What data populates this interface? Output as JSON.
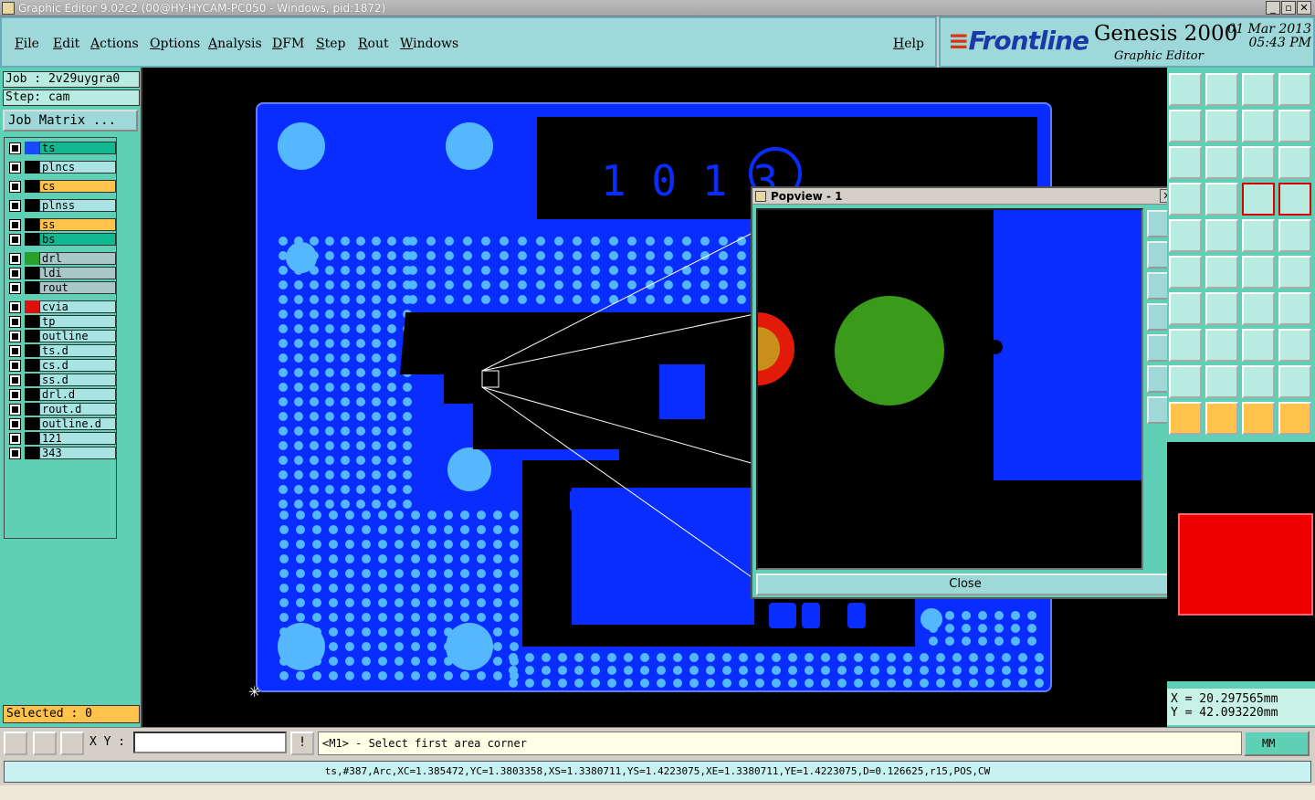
{
  "window": {
    "title": "Graphic Editor 9.02c2 (00@HY-HYCAM-PC050 - Windows, pid:1872)"
  },
  "menu": {
    "items": [
      "File",
      "Edit",
      "Actions",
      "Options",
      "Analysis",
      "DFM",
      "Step",
      "Rout",
      "Windows"
    ],
    "help": "Help"
  },
  "brand": {
    "logo": "Frontline",
    "product": "Genesis 2000",
    "subtitle": "Graphic Editor",
    "date": "01 Mar 2013",
    "time": "05:43 PM"
  },
  "job": {
    "job_label": "Job : 2v29uygra0",
    "step_label": "Step: cam",
    "matrix_button": "Job Matrix ..."
  },
  "layers": [
    {
      "name": "ts",
      "color": "#1a4aff",
      "bg": "#14b890"
    },
    {
      "name": "plncs",
      "color": "#000000",
      "bg": "#a8e4e4"
    },
    {
      "name": "cs",
      "color": "#000000",
      "bg": "#ffc24a"
    },
    {
      "name": "plnss",
      "color": "#000000",
      "bg": "#a8e4e4"
    },
    {
      "name": "ss",
      "color": "#000000",
      "bg": "#ffc24a"
    },
    {
      "name": "bs",
      "color": "#000000",
      "bg": "#14b890"
    },
    {
      "name": "drl",
      "color": "#2aa02a",
      "bg": "#a8c8c8"
    },
    {
      "name": "ldi",
      "color": "#000000",
      "bg": "#a8c8c8"
    },
    {
      "name": "rout",
      "color": "#000000",
      "bg": "#a8c8c8"
    },
    {
      "name": "cvia",
      "color": "#e01010",
      "bg": "#a8e4e4"
    },
    {
      "name": "tp",
      "color": "#000000",
      "bg": "#a8e4e4"
    },
    {
      "name": "outline",
      "color": "#000000",
      "bg": "#a8e4e4"
    },
    {
      "name": "ts.d",
      "color": "#000000",
      "bg": "#a8e4e4"
    },
    {
      "name": "cs.d",
      "color": "#000000",
      "bg": "#a8e4e4"
    },
    {
      "name": "ss.d",
      "color": "#000000",
      "bg": "#a8e4e4"
    },
    {
      "name": "drl.d",
      "color": "#000000",
      "bg": "#a8e4e4"
    },
    {
      "name": "rout.d",
      "color": "#000000",
      "bg": "#a8e4e4"
    },
    {
      "name": "outline.d",
      "color": "#000000",
      "bg": "#a8e4e4"
    },
    {
      "name": "121",
      "color": "#000000",
      "bg": "#a8e4e4"
    },
    {
      "name": "343",
      "color": "#000000",
      "bg": "#a8e4e4"
    }
  ],
  "selected": "Selected : 0",
  "board": {
    "silk_text": "1 0 1 3"
  },
  "popview": {
    "title": "Popview - 1",
    "close": "Close"
  },
  "coords": {
    "x": "X = 20.297565mm",
    "y": "Y = 42.093220mm"
  },
  "bottom": {
    "xy_label": "X Y :",
    "prompt": "<M1> - Select first area corner",
    "units": "MM"
  },
  "status": {
    "text": "ts,#387,Arc,XC=1.385472,YC=1.3803358,XS=1.3380711,YS=1.4223075,XE=1.3380711,YE=1.4223075,D=0.126625,r15,POS,CW"
  },
  "colors": {
    "board": "#0a2dff",
    "pad": "#55b8ff",
    "drill": "#3a9a1a",
    "selected": "#ffc24a",
    "panel": "#5fcfb5"
  }
}
